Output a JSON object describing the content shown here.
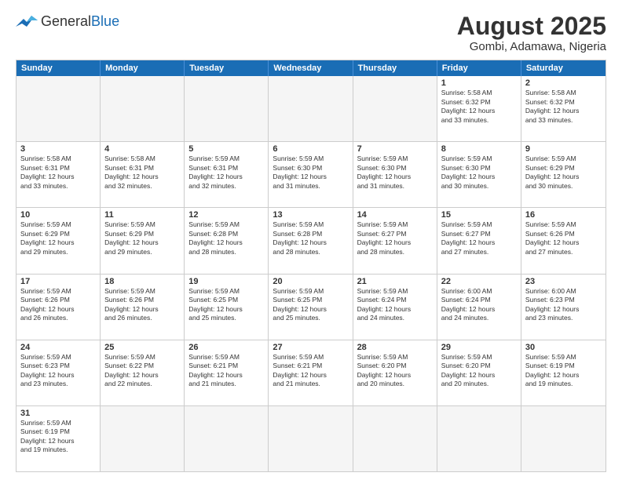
{
  "header": {
    "logo_general": "General",
    "logo_blue": "Blue",
    "title": "August 2025",
    "subtitle": "Gombi, Adamawa, Nigeria"
  },
  "days_of_week": [
    "Sunday",
    "Monday",
    "Tuesday",
    "Wednesday",
    "Thursday",
    "Friday",
    "Saturday"
  ],
  "weeks": [
    [
      {
        "day": "",
        "info": ""
      },
      {
        "day": "",
        "info": ""
      },
      {
        "day": "",
        "info": ""
      },
      {
        "day": "",
        "info": ""
      },
      {
        "day": "",
        "info": ""
      },
      {
        "day": "1",
        "info": "Sunrise: 5:58 AM\nSunset: 6:32 PM\nDaylight: 12 hours\nand 33 minutes."
      },
      {
        "day": "2",
        "info": "Sunrise: 5:58 AM\nSunset: 6:32 PM\nDaylight: 12 hours\nand 33 minutes."
      }
    ],
    [
      {
        "day": "3",
        "info": "Sunrise: 5:58 AM\nSunset: 6:31 PM\nDaylight: 12 hours\nand 33 minutes."
      },
      {
        "day": "4",
        "info": "Sunrise: 5:58 AM\nSunset: 6:31 PM\nDaylight: 12 hours\nand 32 minutes."
      },
      {
        "day": "5",
        "info": "Sunrise: 5:59 AM\nSunset: 6:31 PM\nDaylight: 12 hours\nand 32 minutes."
      },
      {
        "day": "6",
        "info": "Sunrise: 5:59 AM\nSunset: 6:30 PM\nDaylight: 12 hours\nand 31 minutes."
      },
      {
        "day": "7",
        "info": "Sunrise: 5:59 AM\nSunset: 6:30 PM\nDaylight: 12 hours\nand 31 minutes."
      },
      {
        "day": "8",
        "info": "Sunrise: 5:59 AM\nSunset: 6:30 PM\nDaylight: 12 hours\nand 30 minutes."
      },
      {
        "day": "9",
        "info": "Sunrise: 5:59 AM\nSunset: 6:29 PM\nDaylight: 12 hours\nand 30 minutes."
      }
    ],
    [
      {
        "day": "10",
        "info": "Sunrise: 5:59 AM\nSunset: 6:29 PM\nDaylight: 12 hours\nand 29 minutes."
      },
      {
        "day": "11",
        "info": "Sunrise: 5:59 AM\nSunset: 6:29 PM\nDaylight: 12 hours\nand 29 minutes."
      },
      {
        "day": "12",
        "info": "Sunrise: 5:59 AM\nSunset: 6:28 PM\nDaylight: 12 hours\nand 28 minutes."
      },
      {
        "day": "13",
        "info": "Sunrise: 5:59 AM\nSunset: 6:28 PM\nDaylight: 12 hours\nand 28 minutes."
      },
      {
        "day": "14",
        "info": "Sunrise: 5:59 AM\nSunset: 6:27 PM\nDaylight: 12 hours\nand 28 minutes."
      },
      {
        "day": "15",
        "info": "Sunrise: 5:59 AM\nSunset: 6:27 PM\nDaylight: 12 hours\nand 27 minutes."
      },
      {
        "day": "16",
        "info": "Sunrise: 5:59 AM\nSunset: 6:26 PM\nDaylight: 12 hours\nand 27 minutes."
      }
    ],
    [
      {
        "day": "17",
        "info": "Sunrise: 5:59 AM\nSunset: 6:26 PM\nDaylight: 12 hours\nand 26 minutes."
      },
      {
        "day": "18",
        "info": "Sunrise: 5:59 AM\nSunset: 6:26 PM\nDaylight: 12 hours\nand 26 minutes."
      },
      {
        "day": "19",
        "info": "Sunrise: 5:59 AM\nSunset: 6:25 PM\nDaylight: 12 hours\nand 25 minutes."
      },
      {
        "day": "20",
        "info": "Sunrise: 5:59 AM\nSunset: 6:25 PM\nDaylight: 12 hours\nand 25 minutes."
      },
      {
        "day": "21",
        "info": "Sunrise: 5:59 AM\nSunset: 6:24 PM\nDaylight: 12 hours\nand 24 minutes."
      },
      {
        "day": "22",
        "info": "Sunrise: 6:00 AM\nSunset: 6:24 PM\nDaylight: 12 hours\nand 24 minutes."
      },
      {
        "day": "23",
        "info": "Sunrise: 6:00 AM\nSunset: 6:23 PM\nDaylight: 12 hours\nand 23 minutes."
      }
    ],
    [
      {
        "day": "24",
        "info": "Sunrise: 5:59 AM\nSunset: 6:23 PM\nDaylight: 12 hours\nand 23 minutes."
      },
      {
        "day": "25",
        "info": "Sunrise: 5:59 AM\nSunset: 6:22 PM\nDaylight: 12 hours\nand 22 minutes."
      },
      {
        "day": "26",
        "info": "Sunrise: 5:59 AM\nSunset: 6:21 PM\nDaylight: 12 hours\nand 21 minutes."
      },
      {
        "day": "27",
        "info": "Sunrise: 5:59 AM\nSunset: 6:21 PM\nDaylight: 12 hours\nand 21 minutes."
      },
      {
        "day": "28",
        "info": "Sunrise: 5:59 AM\nSunset: 6:20 PM\nDaylight: 12 hours\nand 20 minutes."
      },
      {
        "day": "29",
        "info": "Sunrise: 5:59 AM\nSunset: 6:20 PM\nDaylight: 12 hours\nand 20 minutes."
      },
      {
        "day": "30",
        "info": "Sunrise: 5:59 AM\nSunset: 6:19 PM\nDaylight: 12 hours\nand 19 minutes."
      }
    ],
    [
      {
        "day": "31",
        "info": "Sunrise: 5:59 AM\nSunset: 6:19 PM\nDaylight: 12 hours\nand 19 minutes."
      },
      {
        "day": "",
        "info": ""
      },
      {
        "day": "",
        "info": ""
      },
      {
        "day": "",
        "info": ""
      },
      {
        "day": "",
        "info": ""
      },
      {
        "day": "",
        "info": ""
      },
      {
        "day": "",
        "info": ""
      }
    ]
  ]
}
